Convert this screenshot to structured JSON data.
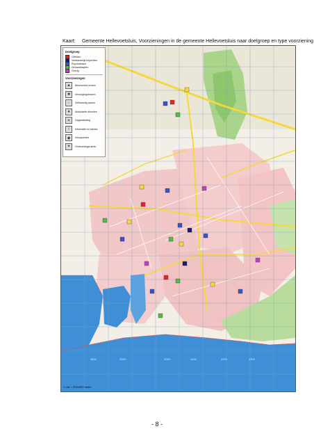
{
  "caption": {
    "label": "Kaart:",
    "text": "Gemeente Hellevoetsluis, Voorzieningen in de gemeente Hellevoetsluis naar doelgroep en type voorziening"
  },
  "legend": {
    "doelgroep_title": "Doelgroep",
    "doelgroep_items": [
      {
        "label": "Cliënten",
        "color": "#e4232b"
      },
      {
        "label": "Verstandelijk beperkten",
        "color": "#1a1a7a"
      },
      {
        "label": "Psychiatrisch",
        "color": "#3a54c8"
      },
      {
        "label": "Gehandicapten",
        "color": "#5ab848"
      },
      {
        "label": "Overig",
        "color": "#c040c0"
      }
    ],
    "voorzieningen_title": "Voorzieningen",
    "voorzieningen_items": [
      {
        "label": "Beschermd wonen",
        "icon": "triangle-icon"
      },
      {
        "label": "Verzorgingshuizen",
        "icon": "square-icon"
      },
      {
        "label": "Zelfstandig wonen",
        "icon": "chevron-icon"
      },
      {
        "label": "Ambulante diensten",
        "icon": "circle-icon"
      },
      {
        "label": "Dagbesteding",
        "icon": "cross-icon"
      },
      {
        "label": "Informatie en advies",
        "icon": "info-icon"
      },
      {
        "label": "Inloopcentra",
        "icon": "diamond-icon"
      },
      {
        "label": "Ontmoetingsruimte",
        "icon": "star-icon"
      }
    ]
  },
  "scale_note": "1 vak = 500x500 meter",
  "grid_labels": [
    "3800",
    "3900",
    "4000",
    "4100",
    "4200",
    "4300"
  ],
  "page_number": "- 8 -",
  "colors": {
    "land": "#f3efe6",
    "urban": "#f2c7c7",
    "water": "#3f8fd6",
    "park": "#a9d48a",
    "road_major": "#f6d83a",
    "road_minor": "#ffffff",
    "grid": "#7aa0c8"
  }
}
